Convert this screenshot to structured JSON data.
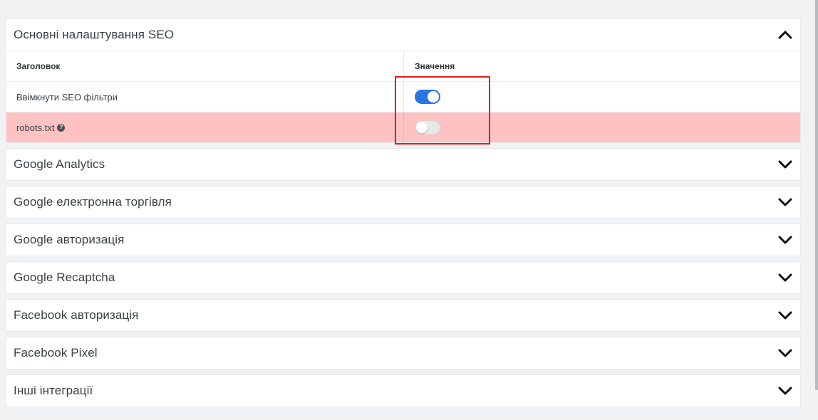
{
  "seo_panel": {
    "title": "Основні налаштування SEO",
    "columns": {
      "title": "Заголовок",
      "value": "Значення"
    },
    "rows": [
      {
        "label": "Ввімкнути SEO фільтри",
        "enabled": true
      },
      {
        "label": "robots.txt",
        "help_icon": "question-circle-icon",
        "enabled": false
      }
    ]
  },
  "panels": [
    {
      "title": "Google Analytics"
    },
    {
      "title": "Google електронна торгівля"
    },
    {
      "title": "Google авторизація"
    },
    {
      "title": "Google Recaptcha"
    },
    {
      "title": "Facebook авторизація"
    },
    {
      "title": "Facebook Pixel"
    },
    {
      "title": "Інші інтеграції"
    }
  ],
  "colors": {
    "toggle_on": "#2b74e4",
    "error_row": "#ffc2c2",
    "highlight_border": "#dd1c1c",
    "background": "#f1f2f4"
  },
  "help_glyph": "?"
}
